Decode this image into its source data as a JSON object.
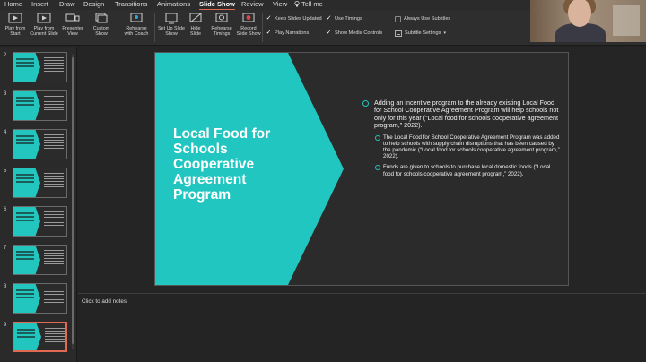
{
  "menu": {
    "tabs": [
      "Home",
      "Insert",
      "Draw",
      "Design",
      "Transitions",
      "Animations",
      "Slide Show",
      "Review",
      "View",
      "Tell me"
    ],
    "active_tab": "Slide Show"
  },
  "ribbon": {
    "buttons": [
      {
        "label": "Play from Start",
        "icon": "play-from-start-icon"
      },
      {
        "label": "Play from Current Slide",
        "icon": "play-from-current-icon"
      },
      {
        "label": "Presenter View",
        "icon": "presenter-view-icon"
      },
      {
        "label": "Custom Show",
        "icon": "custom-show-icon"
      },
      {
        "label": "Rehearse with Coach",
        "icon": "rehearse-coach-icon"
      },
      {
        "label": "Set Up Slide Show",
        "icon": "setup-slideshow-icon"
      },
      {
        "label": "Hide Slide",
        "icon": "hide-slide-icon"
      },
      {
        "label": "Rehearse Timings",
        "icon": "rehearse-timings-icon"
      },
      {
        "label": "Record Slide Show",
        "icon": "record-slideshow-icon"
      }
    ],
    "checks": [
      {
        "label": "Keep Slides Updated",
        "checked": true
      },
      {
        "label": "Use Timings",
        "checked": true
      },
      {
        "label": "Play Narrations",
        "checked": true
      },
      {
        "label": "Show Media Controls",
        "checked": true
      },
      {
        "label": "Always Use Subtitles",
        "checked": false
      }
    ],
    "subtitle_settings": "Subtitle Settings"
  },
  "thumbnails": {
    "numbers": [
      "2",
      "3",
      "4",
      "5",
      "6",
      "7",
      "8",
      "9"
    ],
    "selected": "9"
  },
  "slide": {
    "title": "Local Food for Schools Cooperative Agreement Program",
    "accent_color": "#20C6BF",
    "bullets": [
      {
        "level": 1,
        "text": "Adding an incentive program to the already existing Local Food for School Cooperative Agreement Program will help schools not only for this year (“Local food for schools cooperative agreement program,” 2022)."
      },
      {
        "level": 2,
        "text": "The Local Food for School Cooperative Agreement Program was added to help schools with supply chain disruptions that has been caused by the pandemic (“Local food for schools cooperative agreement program,” 2022)."
      },
      {
        "level": 2,
        "text": "Funds are given to schools to purchase local domestic foods (“Local food for schools cooperative agreement program,” 2022)."
      }
    ]
  },
  "notes": {
    "placeholder": "Click to add notes"
  }
}
